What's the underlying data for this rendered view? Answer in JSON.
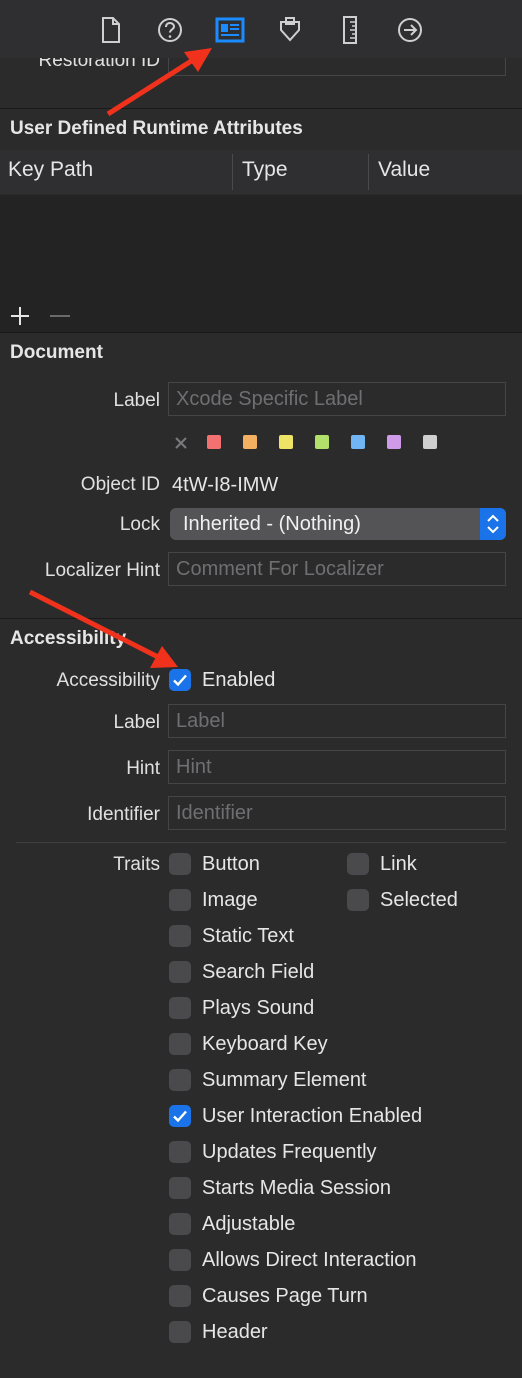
{
  "toolbar": {
    "icons": [
      "file-icon",
      "help-icon",
      "identity-icon",
      "attributes-icon",
      "size-icon",
      "connections-icon"
    ],
    "active": "identity-icon",
    "active_color": "#1a8cff"
  },
  "restoration": {
    "label": "Restoration ID",
    "value": ""
  },
  "runtime_attributes": {
    "title": "User Defined Runtime Attributes",
    "columns": [
      "Key Path",
      "Type",
      "Value"
    ],
    "rows": []
  },
  "document": {
    "title": "Document",
    "label_label": "Label",
    "label_placeholder": "Xcode Specific Label",
    "colors": [
      "#f47171",
      "#f3b061",
      "#efe366",
      "#b3e06a",
      "#71b5f2",
      "#cf9be8",
      "#cfcfcf"
    ],
    "object_id_label": "Object ID",
    "object_id": "4tW-I8-IMW",
    "lock_label": "Lock",
    "lock_value": "Inherited - (Nothing)",
    "localizer_hint_label": "Localizer Hint",
    "localizer_hint_placeholder": "Comment For Localizer"
  },
  "accessibility": {
    "title": "Accessibility",
    "accessibility_label": "Accessibility",
    "enabled_label": "Enabled",
    "enabled": true,
    "label_label": "Label",
    "label_placeholder": "Label",
    "hint_label": "Hint",
    "hint_placeholder": "Hint",
    "identifier_label": "Identifier",
    "identifier_placeholder": "Identifier",
    "traits_label": "Traits",
    "traits": [
      {
        "label": "Button",
        "checked": false
      },
      {
        "label": "Link",
        "checked": false
      },
      {
        "label": "Image",
        "checked": false
      },
      {
        "label": "Selected",
        "checked": false
      },
      {
        "label": "Static Text",
        "checked": false
      },
      {
        "label": "Search Field",
        "checked": false
      },
      {
        "label": "Plays Sound",
        "checked": false
      },
      {
        "label": "Keyboard Key",
        "checked": false
      },
      {
        "label": "Summary Element",
        "checked": false
      },
      {
        "label": "User Interaction Enabled",
        "checked": true
      },
      {
        "label": "Updates Frequently",
        "checked": false
      },
      {
        "label": "Starts Media Session",
        "checked": false
      },
      {
        "label": "Adjustable",
        "checked": false
      },
      {
        "label": "Allows Direct Interaction",
        "checked": false
      },
      {
        "label": "Causes Page Turn",
        "checked": false
      },
      {
        "label": "Header",
        "checked": false
      }
    ]
  },
  "annotation_color": "#f0321c"
}
